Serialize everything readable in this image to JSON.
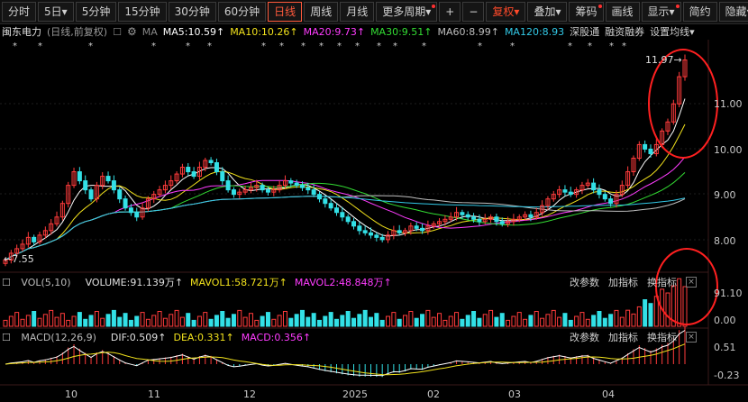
{
  "toolbar": {
    "items": [
      "分时",
      "5日",
      "5分钟",
      "15分钟",
      "30分钟",
      "60分钟",
      "日线",
      "周线",
      "月线",
      "更多周期",
      "+",
      "−",
      "复权",
      "叠加",
      "筹码",
      "画线",
      "显示",
      "简约",
      "隐藏"
    ],
    "five_day_caret": "▾",
    "overlay_caret": "▾",
    "adjust_caret": "▾",
    "more_caret": "▾",
    "display_caret": "▾",
    "hide_caret": "▾"
  },
  "title": {
    "stock_name": "闽东电力",
    "period": "(日线,前复权)",
    "ma_label": "MA",
    "ma5": "MA5:10.59↑",
    "ma10": "MA10:10.26↑",
    "ma20": "MA20:9.73↑",
    "ma30": "MA30:9.51↑",
    "ma60": "MA60:8.99↑",
    "ma120": "MA120:8.93",
    "link1": "深股通",
    "link2": "融资融券",
    "link3": "设置均线▾"
  },
  "price_axis": [
    "11.00",
    "10.00",
    "9.00",
    "8.00"
  ],
  "price_high": "11.97",
  "price_low": "7.55",
  "vol": {
    "label": "VOL(5,10)",
    "volume": "VOLUME:91.139万↑",
    "mavol1": "MAVOL1:58.721万↑",
    "mavol2": "MAVOL2:48.848万↑",
    "axis_top": "91.10",
    "axis_zero": "0.00"
  },
  "macd": {
    "label": "MACD(12,26,9)",
    "dif": "DIF:0.509↑",
    "dea": "DEA:0.331↑",
    "macd": "MACD:0.356↑",
    "axis_top": "0.51",
    "axis_bottom": "-0.23"
  },
  "sub_tools": {
    "param": "改参数",
    "add": "加指标",
    "switch": "换指标",
    "close": "×"
  },
  "dates": [
    "10",
    "11",
    "12",
    "2025",
    "02",
    "03",
    "04"
  ],
  "colors": {
    "up": "#ff3b3b",
    "down": "#33e0e6",
    "ma5": "#ffffff",
    "ma10": "#f2e21c",
    "ma20": "#ff3cff",
    "ma30": "#33dd33",
    "ma60": "#bfbfbf",
    "ma120": "#32c8e6",
    "highlight": "#ff2020"
  },
  "chart_data": {
    "type": "candlestick",
    "title": "闽东电力",
    "ylim": [
      7.4,
      12.1
    ],
    "closes": [
      7.55,
      7.7,
      7.8,
      7.9,
      8.05,
      7.95,
      8.1,
      8.2,
      8.35,
      8.5,
      8.8,
      9.2,
      9.5,
      9.3,
      9.1,
      8.9,
      9.2,
      9.4,
      9.3,
      9.1,
      8.9,
      8.7,
      8.6,
      8.5,
      8.7,
      8.9,
      9.0,
      9.1,
      9.2,
      9.3,
      9.45,
      9.6,
      9.5,
      9.4,
      9.6,
      9.75,
      9.7,
      9.5,
      9.3,
      9.1,
      9.0,
      9.05,
      9.1,
      9.15,
      9.2,
      9.1,
      9.05,
      9.1,
      9.2,
      9.3,
      9.25,
      9.2,
      9.15,
      9.1,
      9.0,
      8.9,
      8.8,
      8.7,
      8.6,
      8.5,
      8.4,
      8.3,
      8.2,
      8.15,
      8.1,
      8.05,
      8.0,
      8.1,
      8.2,
      8.15,
      8.2,
      8.3,
      8.25,
      8.2,
      8.3,
      8.35,
      8.4,
      8.45,
      8.5,
      8.6,
      8.55,
      8.5,
      8.45,
      8.4,
      8.45,
      8.5,
      8.4,
      8.35,
      8.4,
      8.45,
      8.5,
      8.55,
      8.5,
      8.6,
      8.75,
      8.9,
      9.0,
      9.1,
      9.05,
      9.0,
      9.1,
      9.2,
      9.25,
      9.1,
      9.0,
      8.9,
      8.8,
      9.0,
      9.2,
      9.5,
      9.8,
      10.1,
      10.0,
      9.9,
      10.1,
      10.4,
      10.6,
      11.0,
      11.6,
      11.97
    ],
    "volume_latest": "91.139万",
    "macd_last": {
      "DIF": 0.509,
      "DEA": 0.331,
      "MACD": 0.356
    }
  }
}
